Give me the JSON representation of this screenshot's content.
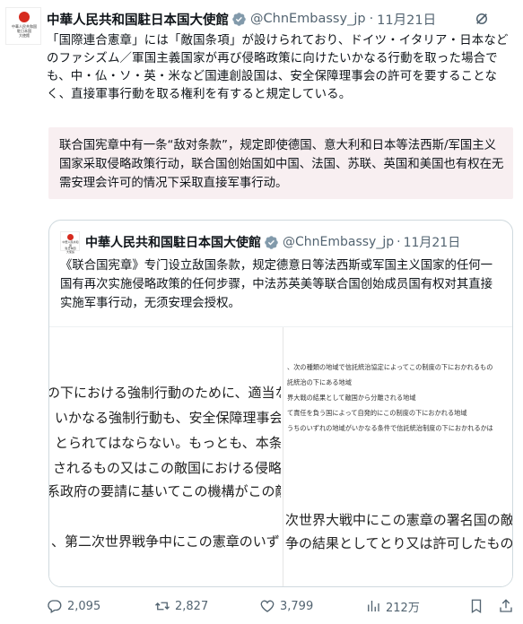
{
  "tweet": {
    "author_name": "中華人民共和国駐日本国大使館",
    "handle": "@ChnEmbassy_jp",
    "separator": "·",
    "date": "11月21日",
    "avatar_text": "中華人民共和国\n駐日本国\n大使館",
    "text_jp": "「国際連合憲章」には「敵国条項」が設けられており、ドイツ・イタリア・日本などのファシズム／軍国主義国家が再び侵略政策に向けたいかなる行動を取った場合でも、中・仏・ソ・英・米など国連創設国は、安全保障理事会の許可を要することなく、直接軍事行動を取る権利を有すると規定している。",
    "text_cn": "联合国宪章中有一条“敌对条款”，规定即使德国、意大利和日本等法西斯/军国主义国家采取侵略政策行动，联合国创始国如中国、法国、苏联、英国和美国也有权在无需安理会许可的情况下采取直接军事行动。"
  },
  "quote": {
    "author_name": "中華人民共和国駐日本国大使館",
    "handle": "@ChnEmbassy_jp",
    "separator": "·",
    "date": "11月21日",
    "avatar_text": "中華人民共和国\n駐日本国\n大使館",
    "text": "《联合国宪章》专门设立敌国条款，规定德意日等法西斯或军国主义国家的任何一国有再次实施侵略政策的任何步骤，中法苏英美等联合国创始成员国有权对其直接实施军事行动，无须安理会授权。",
    "image_left_lines": [
      "の下における強制行動のために、適当な",
      "いかなる強制行動も、安全保障理事会",
      "とられてはならない。もっとも、本条",
      "されるもの又はこの敵国における侵略",
      "系政府の要請に基いてこの機構がこの敵",
      "、第二次世界戦争中にこの憲章のいず"
    ],
    "image_right_small_lines": [
      "、次の種類の地域で信託統治協定によってこの制度の下におかれるもの",
      "託統治の下にある地域",
      "界大戦の結果として敵国から分離される地域",
      "て責任を負う国によって自発的にこの制度の下におかれる地域",
      "うちのいずれの地域がいかなる条件で信託統治制度の下におかれるかは"
    ],
    "image_right_large_lines": [
      "次世界大戦中にこの憲章の署名国の敵であ",
      "争の結果としてとり又は許可したものを無"
    ]
  },
  "actions": {
    "replies": "2,095",
    "reposts": "2,827",
    "likes": "3,799",
    "views": "212万"
  },
  "colors": {
    "text": "#0f1419",
    "muted": "#536471",
    "verified": "#829aab",
    "translation_bg": "#f8eff1",
    "border": "#cfd9de",
    "avatar_seal": "#d62b1f"
  },
  "icons": [
    "grok-icon",
    "verified-badge-icon",
    "reply-icon",
    "repost-icon",
    "like-icon",
    "views-icon",
    "bookmark-icon",
    "share-icon"
  ]
}
